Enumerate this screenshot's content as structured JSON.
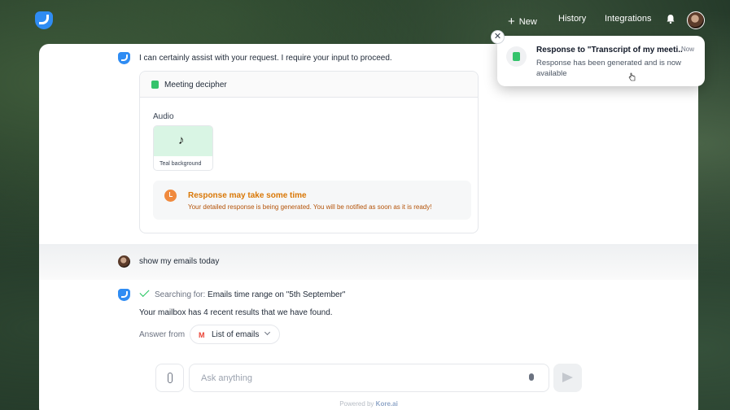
{
  "header": {
    "nav_new": "New",
    "nav_history": "History",
    "nav_integrations": "Integrations"
  },
  "bot_message": {
    "text": "I can certainly assist with your request. I require your input to proceed."
  },
  "card": {
    "title": "Meeting decipher",
    "audio_label": "Audio",
    "audio_file": "Teal background",
    "notice_title": "Response may take some time",
    "notice_body": "Your detailed response is being generated. You will be notified as soon as it is ready!"
  },
  "user_message": {
    "text": "show my emails today"
  },
  "search": {
    "prefix": "Searching for:",
    "query": "Emails time range on \"5th September\"",
    "result": "Your mailbox has 4 recent results that we have found.",
    "answer_from": "Answer from",
    "source": "List of emails"
  },
  "composer": {
    "placeholder": "Ask anything",
    "powered_prefix": "Powered by",
    "powered_brand": "Kore.ai"
  },
  "toast": {
    "title": "Response to \"Transcript of my meeti..",
    "time": "Now",
    "body": "Response has been generated and is now available"
  },
  "colors": {
    "accent": "#2f8cf3",
    "success": "#22c55e",
    "warning": "#d97706"
  }
}
